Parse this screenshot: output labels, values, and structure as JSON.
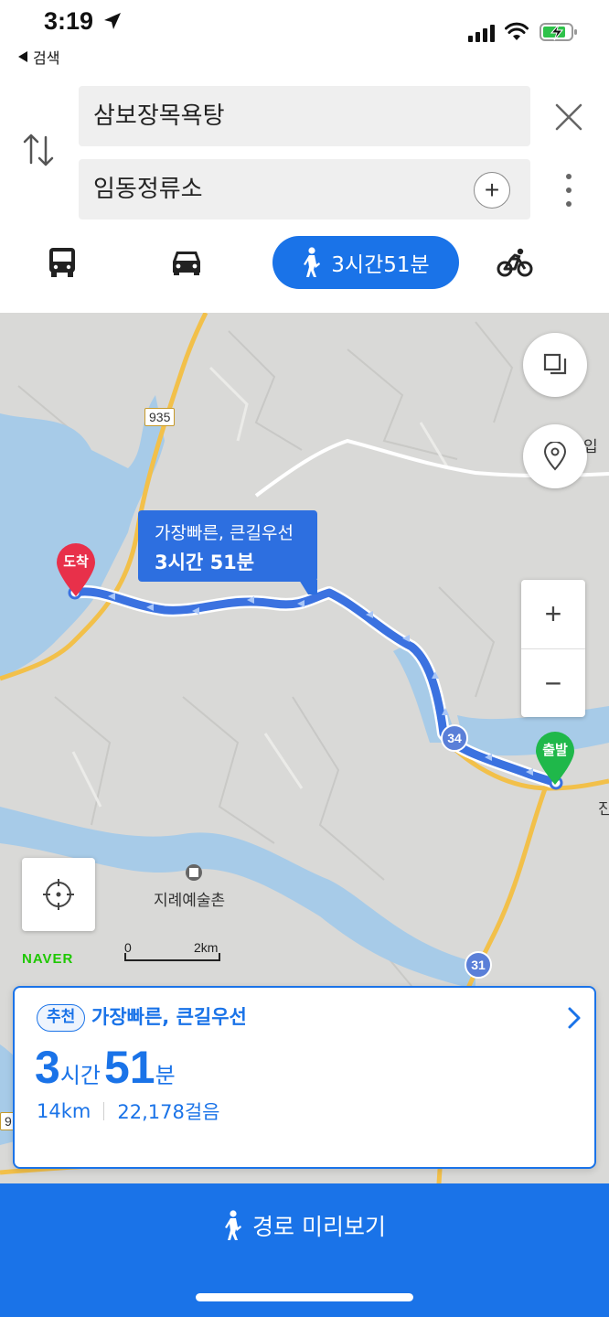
{
  "status_bar": {
    "time": "3:19",
    "back_label": "검색"
  },
  "search": {
    "origin": "삼보장목욕탕",
    "destination": "임동정류소"
  },
  "modes": {
    "walk_duration": "3시간51분"
  },
  "map": {
    "callout": {
      "line1": "가장빠른, 큰길우선",
      "line2": "3시간 51분"
    },
    "arrival_pin": "도착",
    "departure_pin": "출발",
    "place_label": "지례예술촌",
    "edge_label_top": "입",
    "edge_label_mid": "진",
    "road_badges": [
      "935",
      "34",
      "31",
      "9"
    ],
    "brand": "NAVER",
    "scale": {
      "start": "0",
      "end": "2km"
    }
  },
  "summary": {
    "badge": "추천",
    "route_name": "가장빠른, 큰길우선",
    "hours": "3",
    "hours_unit": "시간",
    "minutes": "51",
    "minutes_unit": "분",
    "distance": "14km",
    "steps": "22,178걸음"
  },
  "action": {
    "preview_label": "경로 미리보기"
  },
  "colors": {
    "accent": "#1a73e8",
    "route": "#2d6fe0",
    "arrival_pin": "#e8304a",
    "departure_pin": "#1fb84a"
  }
}
